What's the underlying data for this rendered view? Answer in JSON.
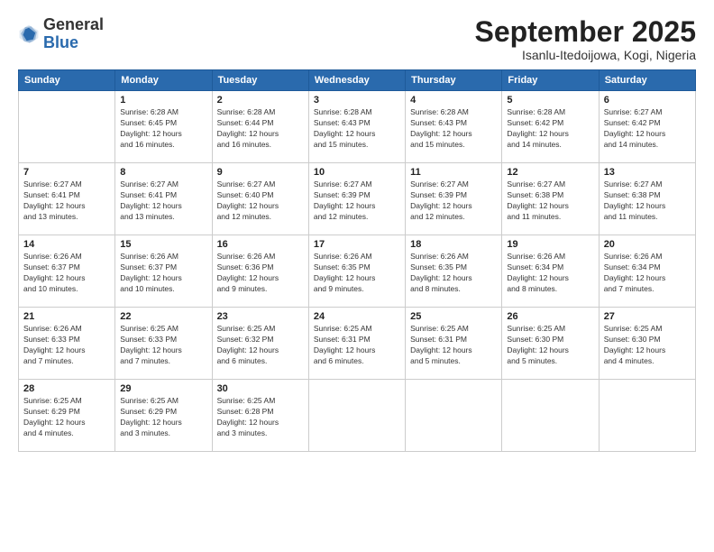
{
  "header": {
    "logo_general": "General",
    "logo_blue": "Blue",
    "month_title": "September 2025",
    "location": "Isanlu-Itedoijowa, Kogi, Nigeria"
  },
  "weekdays": [
    "Sunday",
    "Monday",
    "Tuesday",
    "Wednesday",
    "Thursday",
    "Friday",
    "Saturday"
  ],
  "weeks": [
    [
      {
        "day": "",
        "info": ""
      },
      {
        "day": "1",
        "info": "Sunrise: 6:28 AM\nSunset: 6:45 PM\nDaylight: 12 hours\nand 16 minutes."
      },
      {
        "day": "2",
        "info": "Sunrise: 6:28 AM\nSunset: 6:44 PM\nDaylight: 12 hours\nand 16 minutes."
      },
      {
        "day": "3",
        "info": "Sunrise: 6:28 AM\nSunset: 6:43 PM\nDaylight: 12 hours\nand 15 minutes."
      },
      {
        "day": "4",
        "info": "Sunrise: 6:28 AM\nSunset: 6:43 PM\nDaylight: 12 hours\nand 15 minutes."
      },
      {
        "day": "5",
        "info": "Sunrise: 6:28 AM\nSunset: 6:42 PM\nDaylight: 12 hours\nand 14 minutes."
      },
      {
        "day": "6",
        "info": "Sunrise: 6:27 AM\nSunset: 6:42 PM\nDaylight: 12 hours\nand 14 minutes."
      }
    ],
    [
      {
        "day": "7",
        "info": "Sunrise: 6:27 AM\nSunset: 6:41 PM\nDaylight: 12 hours\nand 13 minutes."
      },
      {
        "day": "8",
        "info": "Sunrise: 6:27 AM\nSunset: 6:41 PM\nDaylight: 12 hours\nand 13 minutes."
      },
      {
        "day": "9",
        "info": "Sunrise: 6:27 AM\nSunset: 6:40 PM\nDaylight: 12 hours\nand 12 minutes."
      },
      {
        "day": "10",
        "info": "Sunrise: 6:27 AM\nSunset: 6:39 PM\nDaylight: 12 hours\nand 12 minutes."
      },
      {
        "day": "11",
        "info": "Sunrise: 6:27 AM\nSunset: 6:39 PM\nDaylight: 12 hours\nand 12 minutes."
      },
      {
        "day": "12",
        "info": "Sunrise: 6:27 AM\nSunset: 6:38 PM\nDaylight: 12 hours\nand 11 minutes."
      },
      {
        "day": "13",
        "info": "Sunrise: 6:27 AM\nSunset: 6:38 PM\nDaylight: 12 hours\nand 11 minutes."
      }
    ],
    [
      {
        "day": "14",
        "info": "Sunrise: 6:26 AM\nSunset: 6:37 PM\nDaylight: 12 hours\nand 10 minutes."
      },
      {
        "day": "15",
        "info": "Sunrise: 6:26 AM\nSunset: 6:37 PM\nDaylight: 12 hours\nand 10 minutes."
      },
      {
        "day": "16",
        "info": "Sunrise: 6:26 AM\nSunset: 6:36 PM\nDaylight: 12 hours\nand 9 minutes."
      },
      {
        "day": "17",
        "info": "Sunrise: 6:26 AM\nSunset: 6:35 PM\nDaylight: 12 hours\nand 9 minutes."
      },
      {
        "day": "18",
        "info": "Sunrise: 6:26 AM\nSunset: 6:35 PM\nDaylight: 12 hours\nand 8 minutes."
      },
      {
        "day": "19",
        "info": "Sunrise: 6:26 AM\nSunset: 6:34 PM\nDaylight: 12 hours\nand 8 minutes."
      },
      {
        "day": "20",
        "info": "Sunrise: 6:26 AM\nSunset: 6:34 PM\nDaylight: 12 hours\nand 7 minutes."
      }
    ],
    [
      {
        "day": "21",
        "info": "Sunrise: 6:26 AM\nSunset: 6:33 PM\nDaylight: 12 hours\nand 7 minutes."
      },
      {
        "day": "22",
        "info": "Sunrise: 6:25 AM\nSunset: 6:33 PM\nDaylight: 12 hours\nand 7 minutes."
      },
      {
        "day": "23",
        "info": "Sunrise: 6:25 AM\nSunset: 6:32 PM\nDaylight: 12 hours\nand 6 minutes."
      },
      {
        "day": "24",
        "info": "Sunrise: 6:25 AM\nSunset: 6:31 PM\nDaylight: 12 hours\nand 6 minutes."
      },
      {
        "day": "25",
        "info": "Sunrise: 6:25 AM\nSunset: 6:31 PM\nDaylight: 12 hours\nand 5 minutes."
      },
      {
        "day": "26",
        "info": "Sunrise: 6:25 AM\nSunset: 6:30 PM\nDaylight: 12 hours\nand 5 minutes."
      },
      {
        "day": "27",
        "info": "Sunrise: 6:25 AM\nSunset: 6:30 PM\nDaylight: 12 hours\nand 4 minutes."
      }
    ],
    [
      {
        "day": "28",
        "info": "Sunrise: 6:25 AM\nSunset: 6:29 PM\nDaylight: 12 hours\nand 4 minutes."
      },
      {
        "day": "29",
        "info": "Sunrise: 6:25 AM\nSunset: 6:29 PM\nDaylight: 12 hours\nand 3 minutes."
      },
      {
        "day": "30",
        "info": "Sunrise: 6:25 AM\nSunset: 6:28 PM\nDaylight: 12 hours\nand 3 minutes."
      },
      {
        "day": "",
        "info": ""
      },
      {
        "day": "",
        "info": ""
      },
      {
        "day": "",
        "info": ""
      },
      {
        "day": "",
        "info": ""
      }
    ]
  ]
}
